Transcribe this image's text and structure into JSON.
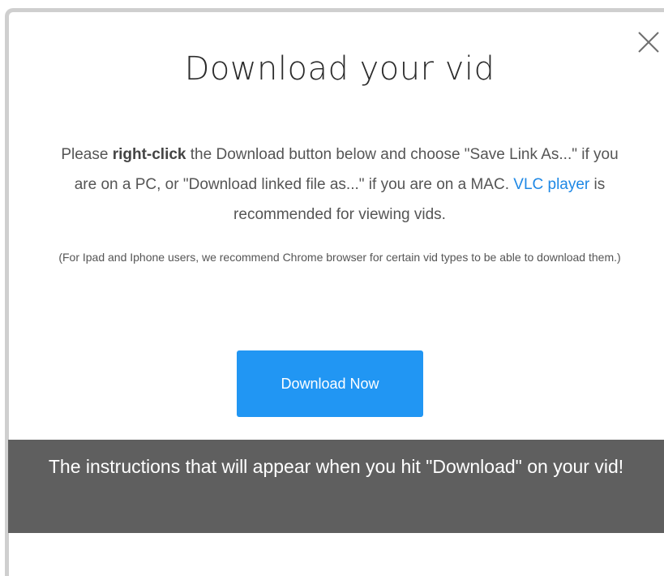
{
  "modal": {
    "title": "Download your vid",
    "close_icon": "close-icon",
    "instructions": {
      "part1": "Please ",
      "bold": "right-click",
      "part2": " the Download button below and choose \"Save Link As...\" if you are on a PC, or \"Download linked file as...\" if you are on a MAC. ",
      "link": "VLC player",
      "part3": " is recommended for viewing vids."
    },
    "note": "(For Ipad and Iphone users, we recommend Chrome browser for certain vid types to be able to download them.)",
    "download_button": "Download Now"
  },
  "caption": "The instructions that will appear when you hit \"Download\" on your vid!",
  "colors": {
    "button": "#2196f3",
    "link": "#1e88e5",
    "caption_bg": "#5f5f5f"
  }
}
